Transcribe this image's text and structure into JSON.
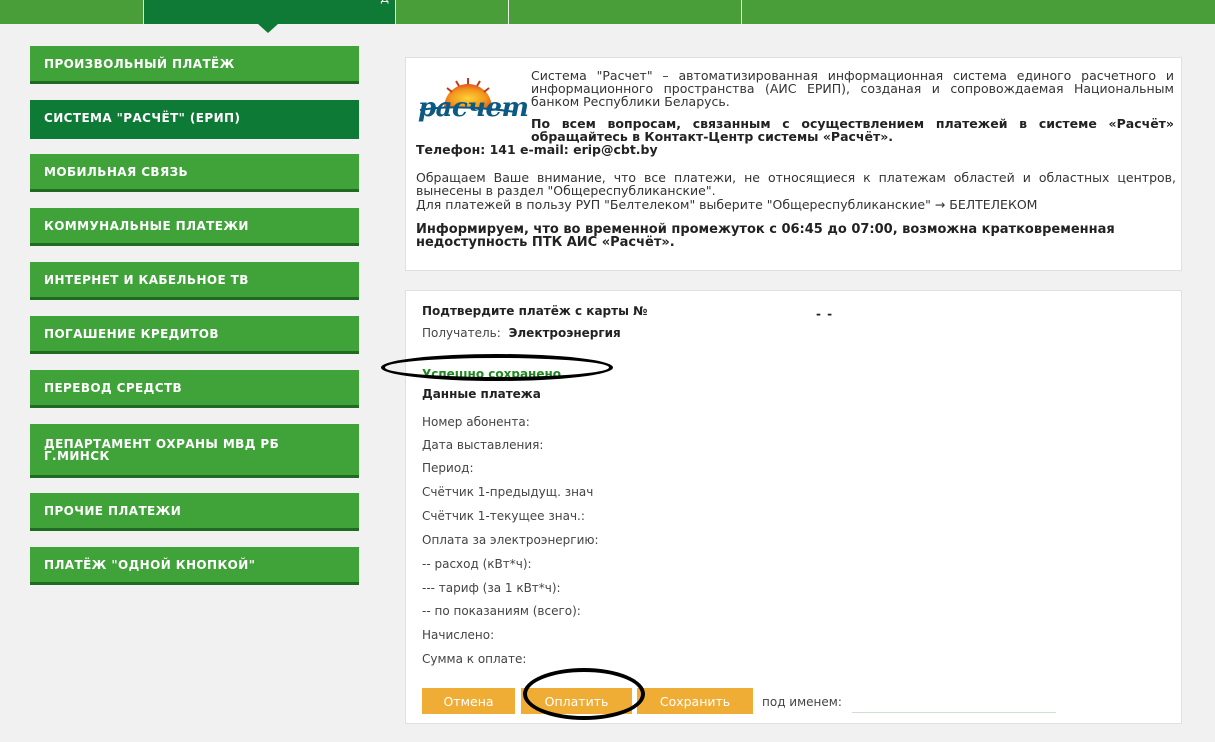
{
  "topnav": {
    "active_label_fragment": "Д"
  },
  "sidebar": {
    "items": [
      {
        "label": "ПРОИЗВОЛЬНЫЙ ПЛАТЁЖ"
      },
      {
        "label": "СИСТЕМА \"РАСЧЁТ\" (ЕРИП)"
      },
      {
        "label": "МОБИЛЬНАЯ СВЯЗЬ"
      },
      {
        "label": "КОММУНАЛЬНЫЕ ПЛАТЕЖИ"
      },
      {
        "label": "ИНТЕРНЕТ И КАБЕЛЬНОЕ ТВ"
      },
      {
        "label": "ПОГАШЕНИЕ КРЕДИТОВ"
      },
      {
        "label": "ПЕРЕВОД СРЕДСТВ"
      },
      {
        "label": "ДЕПАРТАМЕНТ ОХРАНЫ МВД РБ Г.МИНСК"
      },
      {
        "label": "ПРОЧИЕ ПЛАТЕЖИ"
      },
      {
        "label": "ПЛАТЁЖ \"ОДНОЙ КНОПКОЙ\""
      }
    ],
    "active_index": 1
  },
  "info": {
    "logo_text": "расчет",
    "logo_icon": "sun-rays-icon",
    "p1": "Система \"Расчет\" – автоматизированная информационная система единого расчетного и информационного пространства (АИС ЕРИП), созданая и сопровождаемая Национальным банком Республики Беларусь.",
    "p2": "По всем вопросам, связанным с осуществлением платежей в системе «Расчёт» обращайтесь в Контакт-Центр системы «Расчёт».",
    "p3": "Телефон: 141    e-mail: erip@cbt.by",
    "p4": "Обращаем Ваше внимание, что все платежи, не относящиеся к платежам областей и областных центров, вынесены в раздел \"Общереспубликанские\".",
    "p5": "Для платежей в пользу РУП \"Белтелеком\" выберите \"Общереспубликанские\" → БЕЛТЕЛЕКОМ",
    "p6": "Информируем, что во временной промежуток с 06:45 до 07:00, возможна кратковременная недоступность ПТК АИС «Расчёт»."
  },
  "form": {
    "confirm_label": "Подтвердите платёж с карты №",
    "card_mask": "-        -",
    "recipient_label": "Получатель:",
    "recipient_value": "Электроэнергия",
    "success_text": "Успешно сохранено",
    "section_title": "Данные платежа",
    "fields": [
      "Номер абонента:",
      "Дата выставления:",
      "Период:",
      "Счётчик 1-предыдущ. знач",
      "Счётчик 1-текущее знач.:",
      "Оплата за электроэнергию:",
      "-- расход (кВт*ч):",
      "--- тариф (за 1 кВт*ч):",
      "-- по показаниям (всего):",
      "Начислено:",
      "Сумма к оплате:"
    ],
    "buttons": {
      "cancel": "Отмена",
      "pay": "Оплатить",
      "save": "Сохранить"
    },
    "name_label": "под именем:",
    "name_value": ""
  },
  "colors": {
    "sidebar_green": "#3fa33a",
    "active_green": "#0d7a35",
    "button_orange": "#f0ad36",
    "success_green": "#1c8a1c"
  }
}
